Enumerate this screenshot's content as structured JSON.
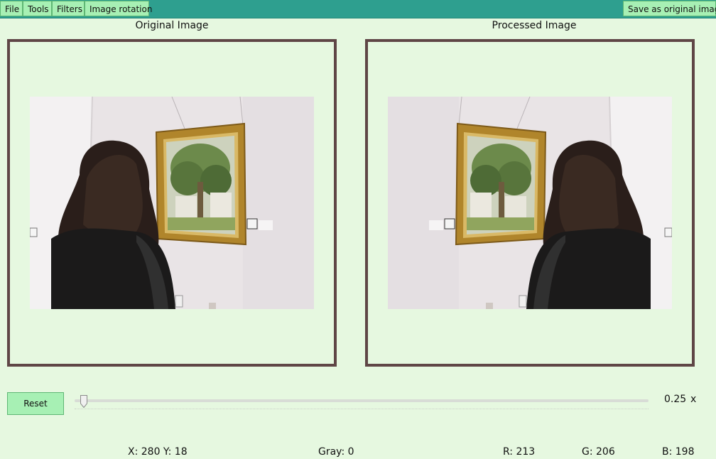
{
  "menu": {
    "items": [
      "File",
      "Tools",
      "Filters",
      "Image rotation"
    ],
    "save_button": "Save as original image"
  },
  "panels": {
    "original_title": "Original Image",
    "processed_title": "Processed Image"
  },
  "controls": {
    "reset_label": "Reset",
    "zoom_value": "0.25",
    "zoom_unit": "x",
    "slider_fraction": 0.01
  },
  "status": {
    "coords": "X: 280 Y: 18",
    "gray": "Gray: 0",
    "r": "R: 213",
    "g": "G: 206",
    "b": "B: 198"
  },
  "colors": {
    "menubar": "#2e9f8f",
    "button_bg": "#a7f0b4",
    "frame_border": "#5f4646",
    "background": "#e6f8e0"
  }
}
